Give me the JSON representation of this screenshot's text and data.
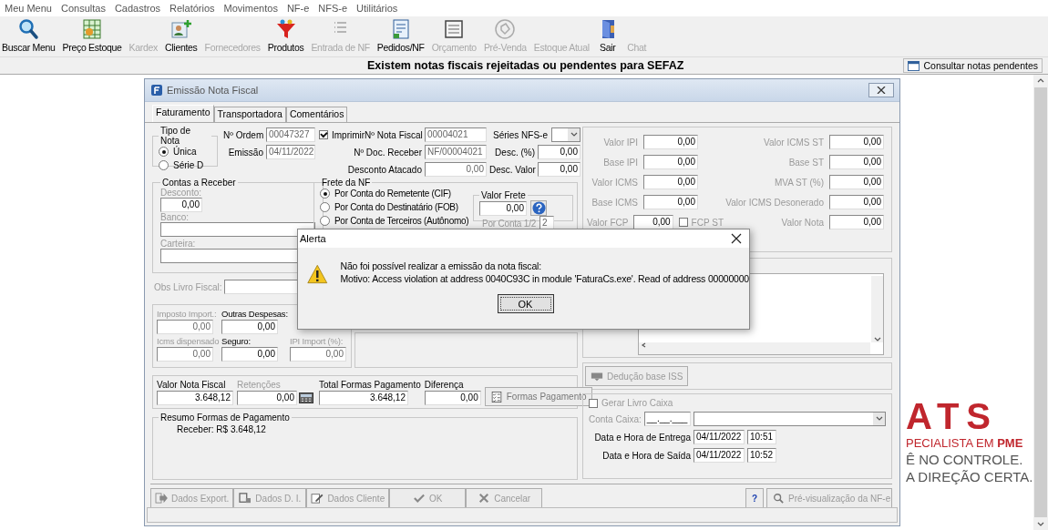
{
  "menu": [
    "Meu Menu",
    "Consultas",
    "Cadastros",
    "Relatórios",
    "Movimentos",
    "NF-e",
    "NFS-e",
    "Utilitários"
  ],
  "toolbar": [
    {
      "label": "Buscar Menu",
      "disabled": false
    },
    {
      "label": "Preço Estoque",
      "disabled": false
    },
    {
      "label": "Kardex",
      "disabled": true
    },
    {
      "label": "Clientes",
      "disabled": false
    },
    {
      "label": "Fornecedores",
      "disabled": true
    },
    {
      "label": "Produtos",
      "disabled": false
    },
    {
      "label": "Entrada de NF",
      "disabled": true
    },
    {
      "label": "Pedidos/NF",
      "disabled": false
    },
    {
      "label": "Orçamento",
      "disabled": true
    },
    {
      "label": "Pré-Venda",
      "disabled": true
    },
    {
      "label": "Estoque Atual",
      "disabled": true
    },
    {
      "label": "Sair",
      "disabled": false
    },
    {
      "label": "Chat",
      "disabled": true
    }
  ],
  "notice": {
    "text": "Existem notas fiscais rejeitadas ou pendentes para SEFAZ",
    "button": "Consultar notas pendentes"
  },
  "background_logo": {
    "lines": [
      "ATS",
      "PECIALISTA EM **PME**",
      "Ê NO CONTROLE.",
      "A DIREÇÃO CERTA."
    ]
  },
  "window": {
    "title": "Emissão Nota Fiscal",
    "tabs": [
      {
        "label": "Faturamento",
        "selected": true
      },
      {
        "label": "Transportadora",
        "selected": false
      },
      {
        "label": "Comentários",
        "selected": false
      }
    ]
  },
  "form": {
    "tipo_nota": {
      "title": "Tipo de Nota",
      "options": [
        {
          "label": "Única",
          "selected": true
        },
        {
          "label": "Série D",
          "selected": false
        }
      ]
    },
    "ordem": {
      "label": "Nº Ordem",
      "value": "00047327"
    },
    "imprimir": {
      "label": "Imprimir",
      "checked": true
    },
    "nota_fiscal": {
      "label": "Nº Nota Fiscal",
      "value": "00004021"
    },
    "series_nfse": {
      "label": "Séries NFS-e"
    },
    "emissao": {
      "label": "Emissão",
      "value": "04/11/2022"
    },
    "doc_receber": {
      "label": "Nº Doc. Receber",
      "value": "NF/00004021"
    },
    "desc_pct": {
      "label": "Desc. (%)",
      "value": "0,00"
    },
    "desconto_atacado": {
      "label": "Desconto Atacado",
      "value": "0,00"
    },
    "desc_valor": {
      "label": "Desc. Valor",
      "value": "0,00"
    },
    "taxes": [
      {
        "label": "Valor IPI",
        "value": "0,00"
      },
      {
        "label": "Valor ICMS ST",
        "value": "0,00"
      },
      {
        "label": "Base IPI",
        "value": "0,00"
      },
      {
        "label": "Base ST",
        "value": "0,00"
      },
      {
        "label": "Valor ICMS",
        "value": "0,00"
      },
      {
        "label": "MVA ST (%)",
        "value": "0,00"
      },
      {
        "label": "Base ICMS",
        "value": "0,00"
      },
      {
        "label": "Valor ICMS Desonerado",
        "value": "0,00"
      },
      {
        "label": "Valor FCP",
        "value": "0,00"
      },
      {
        "label": "Valor Nota",
        "value": "0,00"
      }
    ],
    "fcp_st": {
      "label": "FCP ST",
      "checked": false
    },
    "contas": {
      "title": "Contas a Receber",
      "desconto_label": "Desconto:",
      "desconto_value": "0,00",
      "banco_label": "Banco:",
      "carteira_label": "Carteira:"
    },
    "frete": {
      "title": "Frete da NF",
      "options": [
        {
          "label": "Por Conta do Remetente (CIF)",
          "selected": true
        },
        {
          "label": "Por Conta do Destinatário (FOB)",
          "selected": false
        },
        {
          "label": "Por Conta de Terceiros (Autônomo)",
          "selected": false
        }
      ],
      "valor_frete": {
        "title": "Valor Frete",
        "value": "0,00"
      },
      "por_conta": {
        "label": "Por Conta 1/2",
        "value": "2"
      }
    },
    "obs_livro": {
      "label": "Obs Livro Fiscal:"
    },
    "extras": [
      {
        "label": "Imposto Import.:",
        "value": "0,00",
        "disabled": true
      },
      {
        "label": "Outras Despesas:",
        "value": "0,00",
        "disabled": false
      },
      {
        "label": "Icms dispensado",
        "value": "0,00",
        "disabled": true
      },
      {
        "label": "Seguro:",
        "value": "0,00",
        "disabled": false
      },
      {
        "label": "IPI Import (%):",
        "value": "0,00",
        "disabled": true
      }
    ],
    "deducao_button": "Dedução base ISS",
    "totals": [
      {
        "label": "Valor Nota Fiscal",
        "value": "3.648,12",
        "disabled": false
      },
      {
        "label": "Retenções",
        "value": "0,00",
        "disabled": true
      },
      {
        "label": "Total Formas Pagamento",
        "value": "3.648,12",
        "disabled": false
      },
      {
        "label": "Diferença",
        "value": "0,00",
        "disabled": false
      }
    ],
    "formas_button": "Formas Pagamento",
    "resumo": {
      "title": "Resumo Formas de Pagamento",
      "text": "Receber: R$ 3.648,12"
    },
    "caixa": {
      "gerar": {
        "label": "Gerar Livro Caixa",
        "checked": false
      },
      "conta_label": "Conta Caixa:",
      "conta_value": "__.__.___",
      "rows": [
        {
          "label": "Data e Hora de Entrega",
          "date": "04/11/2022",
          "time": "10:51"
        },
        {
          "label": "Data e Hora de Saída",
          "date": "04/11/2022",
          "time": "10:52"
        }
      ]
    },
    "buttons": [
      {
        "label": "Dados Export.",
        "disabled": true
      },
      {
        "label": "Dados D. I.",
        "disabled": true
      },
      {
        "label": "Dados Cliente",
        "disabled": true
      },
      {
        "label": "OK",
        "disabled": true
      },
      {
        "label": "Cancelar",
        "disabled": true
      }
    ],
    "help": "?",
    "preview_button": "Pré-visualização da NF-e"
  },
  "alert": {
    "title": "Alerta",
    "lines": [
      "Não foi possível realizar a emissão da nota fiscal:",
      "Motivo: Access violation at address 0040C93C in module 'FaturaCs.exe'. Read of address 00000000"
    ],
    "button": "OK"
  }
}
